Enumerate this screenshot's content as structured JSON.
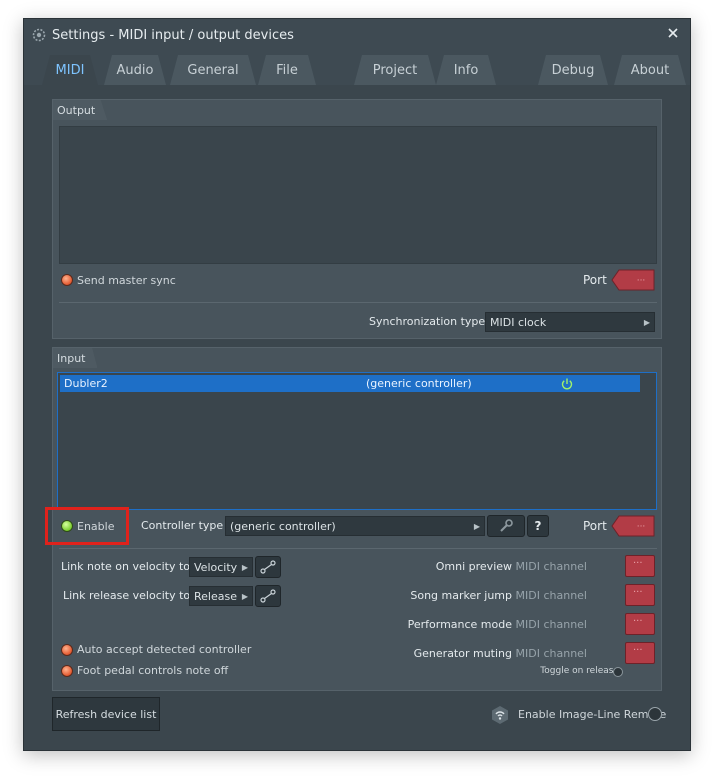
{
  "window": {
    "title": "Settings - MIDI input / output devices"
  },
  "tabs": [
    {
      "label": "MIDI",
      "active": true
    },
    {
      "label": "Audio"
    },
    {
      "label": "General"
    },
    {
      "label": "File"
    },
    {
      "label": "Project"
    },
    {
      "label": "Info"
    },
    {
      "label": "Debug"
    },
    {
      "label": "About"
    }
  ],
  "output": {
    "section_label": "Output",
    "send_master_sync": "Send master sync",
    "port_label": "Port",
    "sync_type_label": "Synchronization type",
    "sync_type_value": "MIDI clock"
  },
  "input": {
    "section_label": "Input",
    "devices": [
      {
        "name": "Dubler2",
        "controller": "(generic controller)",
        "selected": true,
        "enabled": true
      }
    ],
    "enable_label": "Enable",
    "controller_type_label": "Controller type",
    "controller_type_value": "(generic controller)",
    "help_label": "?",
    "port_label": "Port",
    "link_note_velocity_label": "Link note on velocity to",
    "link_note_velocity_value": "Velocity",
    "link_release_velocity_label": "Link release velocity to",
    "link_release_velocity_value": "Release",
    "auto_accept": "Auto accept detected controller",
    "foot_pedal": "Foot pedal controls note off",
    "omni_preview": "Omni preview",
    "song_marker_jump": "Song marker jump",
    "performance_mode": "Performance mode",
    "generator_muting": "Generator muting",
    "midi_channel": "MIDI channel",
    "toggle_on_release": "Toggle on release"
  },
  "footer": {
    "refresh_button": "Refresh device list",
    "enable_remote": "Enable Image-Line Remote"
  },
  "colors": {
    "accent_blue": "#1e6fc7",
    "active_tab_text": "#7ec4ff",
    "led_orange": "#e2582f",
    "led_green": "#7acd2d",
    "port_red": "#b23c46",
    "highlight_box": "#e0221c"
  }
}
